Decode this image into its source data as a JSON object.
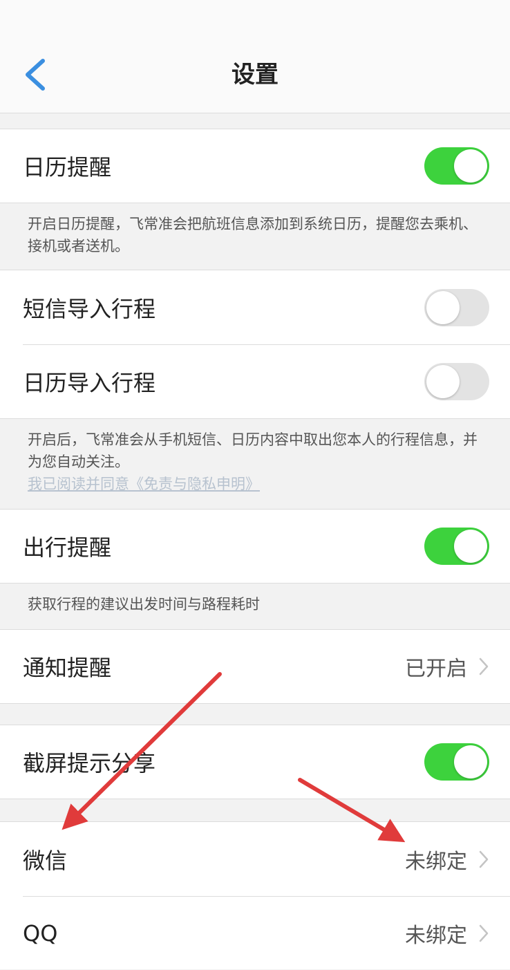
{
  "header": {
    "title": "设置"
  },
  "rows": {
    "calendar_reminder": {
      "label": "日历提醒",
      "toggle": "on"
    },
    "calendar_note": "开启日历提醒，飞常准会把航班信息添加到系统日历，提醒您去乘机、接机或者送机。",
    "sms_import": {
      "label": "短信导入行程",
      "toggle": "off"
    },
    "calendar_import": {
      "label": "日历导入行程",
      "toggle": "off"
    },
    "import_note": "开启后，飞常准会从手机短信、日历内容中取出您本人的行程信息，并为您自动关注。",
    "import_link": "我已阅读并同意《免责与隐私申明》",
    "travel_reminder": {
      "label": "出行提醒",
      "toggle": "on"
    },
    "travel_note": "获取行程的建议出发时间与路程耗时",
    "notification": {
      "label": "通知提醒",
      "value": "已开启"
    },
    "screenshot_share": {
      "label": "截屏提示分享",
      "toggle": "on"
    },
    "wechat": {
      "label": "微信",
      "value": "未绑定"
    },
    "qq": {
      "label": "QQ",
      "value": "未绑定"
    }
  },
  "colors": {
    "toggle_on": "#3dd23d",
    "toggle_off": "#e3e3e3",
    "back_arrow": "#3b8fe0",
    "annotation_arrow": "#e03b3b"
  }
}
